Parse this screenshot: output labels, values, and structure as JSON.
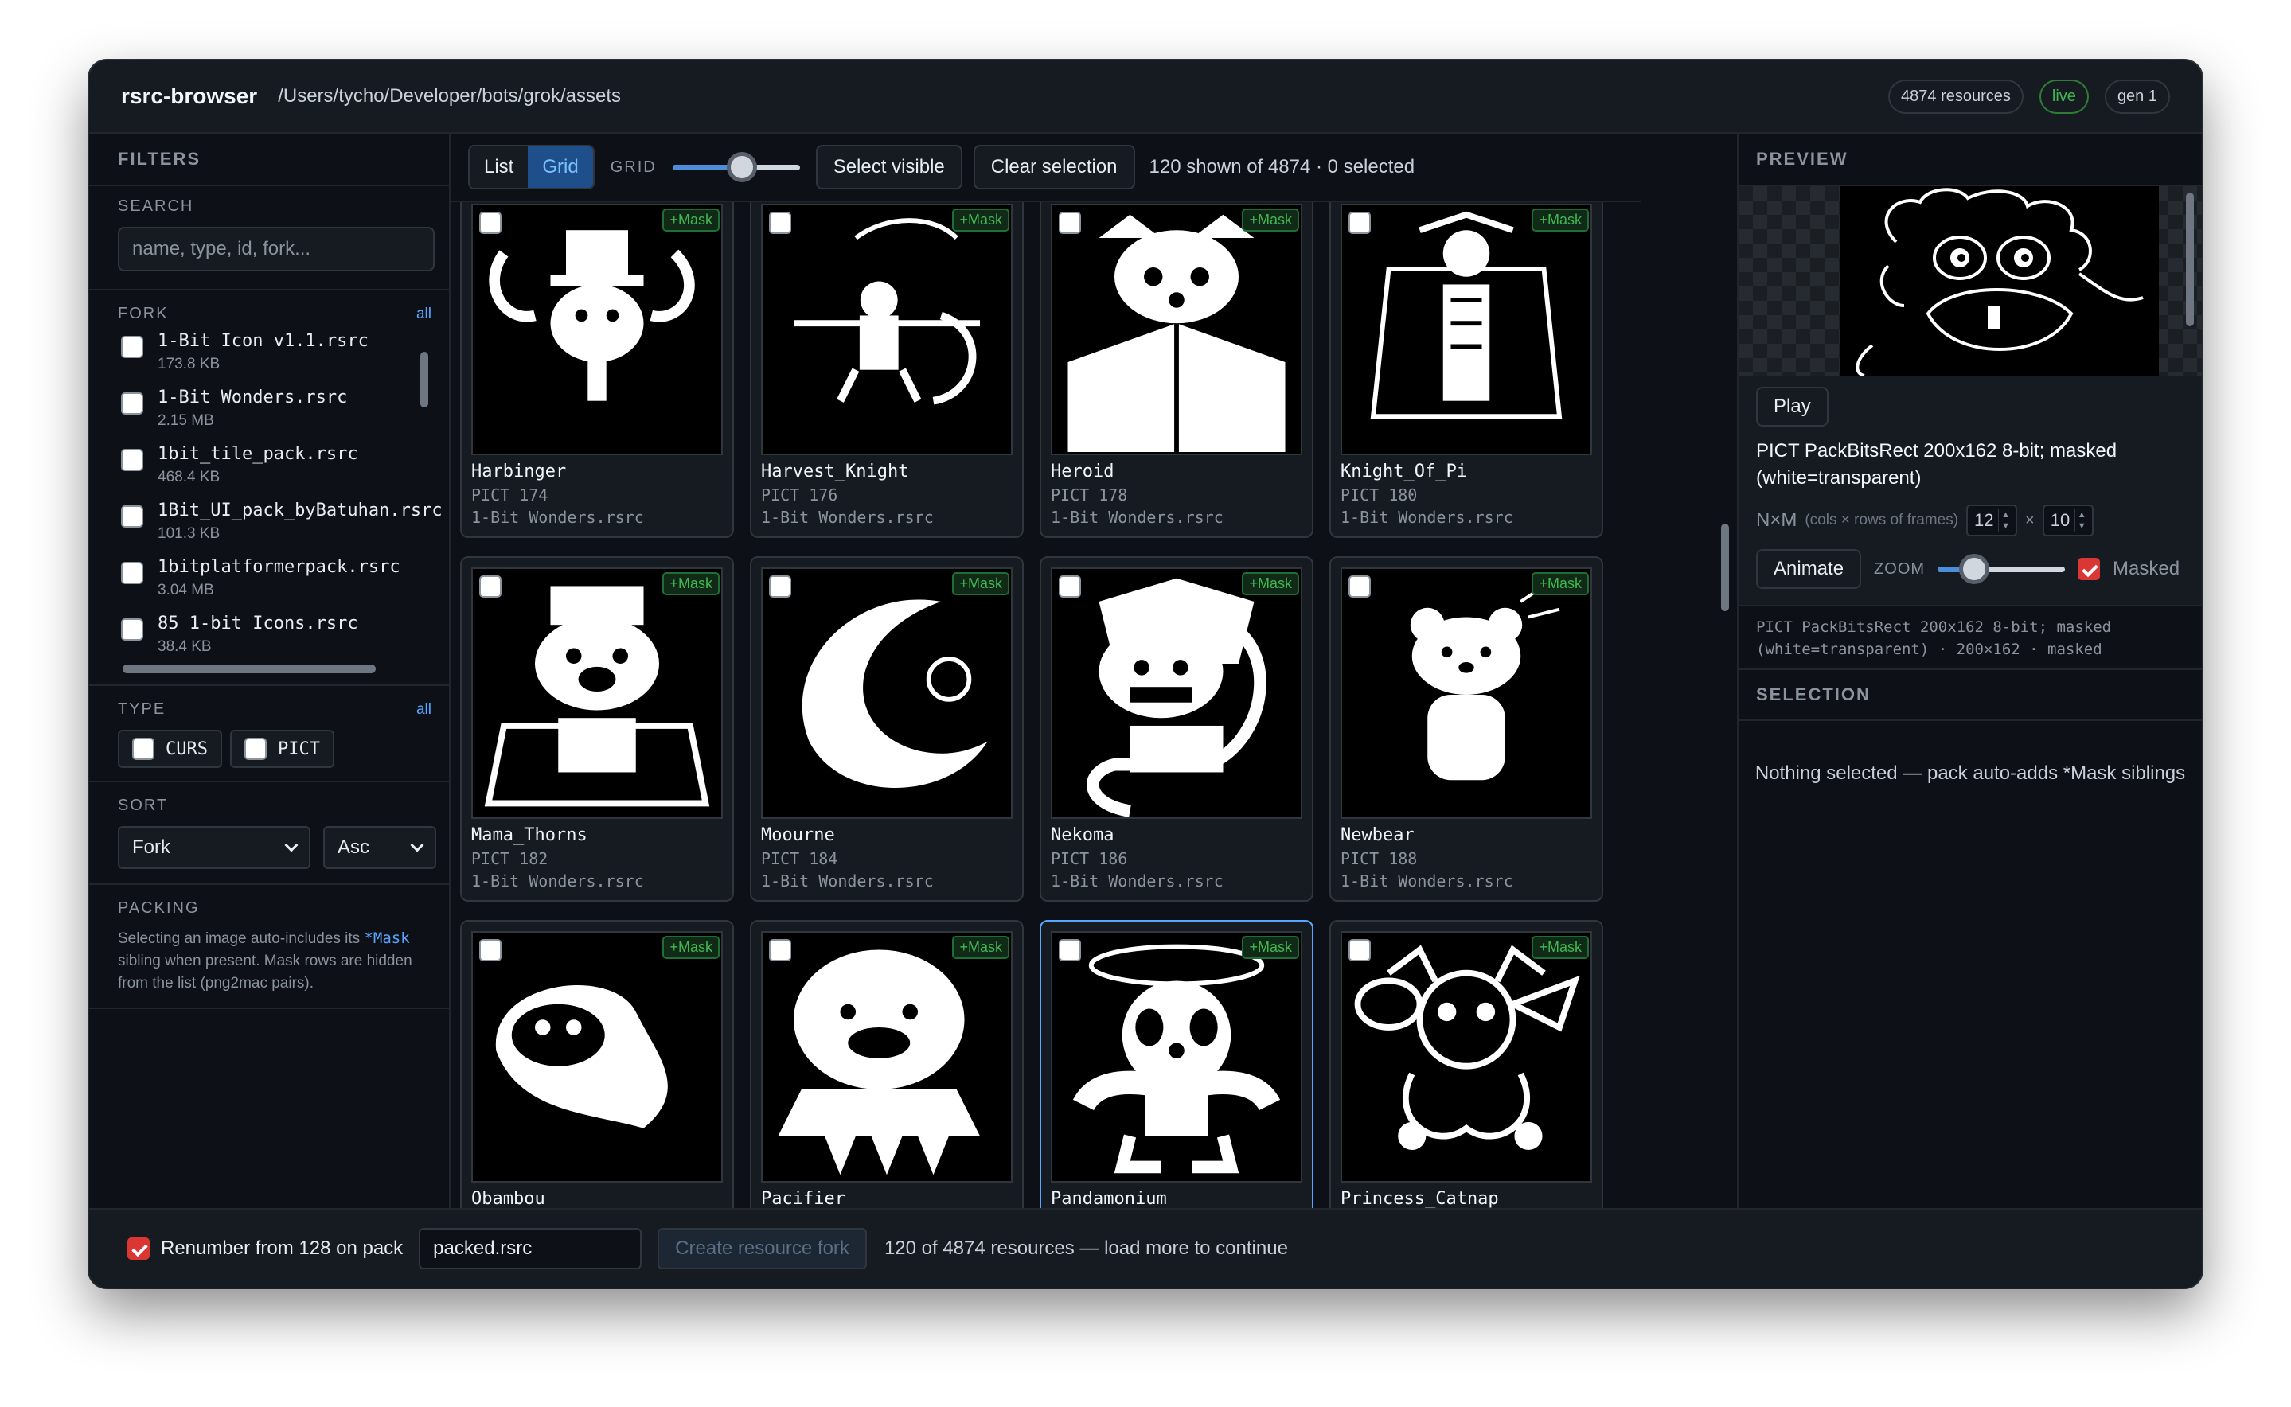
{
  "app": {
    "name": "rsrc-browser",
    "path": "/Users/tycho/Developer/bots/grok/assets",
    "badges": {
      "resources": "4874 resources",
      "live": "live",
      "gen": "gen 1"
    }
  },
  "sidebar": {
    "title": "FILTERS",
    "search": {
      "label": "SEARCH",
      "placeholder": "name, type, id, fork..."
    },
    "fork": {
      "label": "FORK",
      "all": "all",
      "items": [
        {
          "name": "1-Bit Icon v1.1.rsrc",
          "size": "173.8 KB"
        },
        {
          "name": "1-Bit Wonders.rsrc",
          "size": "2.15 MB"
        },
        {
          "name": "1bit_tile_pack.rsrc",
          "size": "468.4 KB"
        },
        {
          "name": "1Bit_UI_pack_byBatuhan.rsrc",
          "size": "101.3 KB"
        },
        {
          "name": "1bitplatformerpack.rsrc",
          "size": "3.04 MB"
        },
        {
          "name": "85 1-bit Icons.rsrc",
          "size": "38.4 KB"
        }
      ]
    },
    "type": {
      "label": "TYPE",
      "all": "all",
      "items": [
        "CURS",
        "PICT"
      ]
    },
    "sort": {
      "label": "SORT",
      "field": "Fork",
      "order": "Asc"
    },
    "packing": {
      "label": "PACKING",
      "text_before": "Selecting an image auto-includes its ",
      "mask_word": "*Mask",
      "text_after": " sibling when present. Mask rows are hidden from the list (png2mac pairs)."
    }
  },
  "toolbar": {
    "list": "List",
    "grid": "Grid",
    "grid_label": "GRID",
    "grid_slider_level": 0.56,
    "select_visible": "Select visible",
    "clear_selection": "Clear selection",
    "count": "120 shown of 4874 · 0 selected"
  },
  "cards": [
    {
      "name": "Harbinger",
      "type": "PICT 174",
      "fork": "1-Bit Wonders.rsrc",
      "badge": "+Mask"
    },
    {
      "name": "Harvest_Knight",
      "type": "PICT 176",
      "fork": "1-Bit Wonders.rsrc",
      "badge": "+Mask"
    },
    {
      "name": "Heroid",
      "type": "PICT 178",
      "fork": "1-Bit Wonders.rsrc",
      "badge": "+Mask"
    },
    {
      "name": "Knight_Of_Pi",
      "type": "PICT 180",
      "fork": "1-Bit Wonders.rsrc",
      "badge": "+Mask"
    },
    {
      "name": "Mama_Thorns",
      "type": "PICT 182",
      "fork": "1-Bit Wonders.rsrc",
      "badge": "+Mask"
    },
    {
      "name": "Moourne",
      "type": "PICT 184",
      "fork": "1-Bit Wonders.rsrc",
      "badge": "+Mask"
    },
    {
      "name": "Nekoma",
      "type": "PICT 186",
      "fork": "1-Bit Wonders.rsrc",
      "badge": "+Mask"
    },
    {
      "name": "Newbear",
      "type": "PICT 188",
      "fork": "1-Bit Wonders.rsrc",
      "badge": "+Mask"
    },
    {
      "name": "Obambou",
      "type": "",
      "fork": "",
      "badge": "+Mask"
    },
    {
      "name": "Pacifier",
      "type": "",
      "fork": "",
      "badge": "+Mask"
    },
    {
      "name": "Pandamonium",
      "type": "",
      "fork": "",
      "badge": "+Mask"
    },
    {
      "name": "Princess_Catnap",
      "type": "",
      "fork": "",
      "badge": "+Mask"
    }
  ],
  "preview": {
    "title": "PREVIEW",
    "play": "Play",
    "description": "PICT PackBitsRect 200x162 8-bit; masked (white=transparent)",
    "nm_label": "N×M",
    "nm_hint": "(cols × rows of frames)",
    "cols": "12",
    "times": "×",
    "rows": "10",
    "animate": "Animate",
    "zoom_label": "ZOOM",
    "zoom_level": 0.22,
    "masked_label": "Masked",
    "meta": "PICT PackBitsRect 200x162 8-bit; masked (white=transparent) · 200×162 · masked"
  },
  "selection": {
    "title": "SELECTION",
    "empty": "Nothing selected — pack auto-adds *Mask siblings"
  },
  "bottom": {
    "renumber": "Renumber from 128 on pack",
    "output_value": "packed.rsrc",
    "create": "Create resource fork",
    "status": "120 of 4874 resources — load more to continue"
  },
  "colors": {
    "accent": "#58a6ff",
    "mask_green": "#3fb950",
    "checked_red": "#da3633",
    "bg": "#0d1117"
  }
}
